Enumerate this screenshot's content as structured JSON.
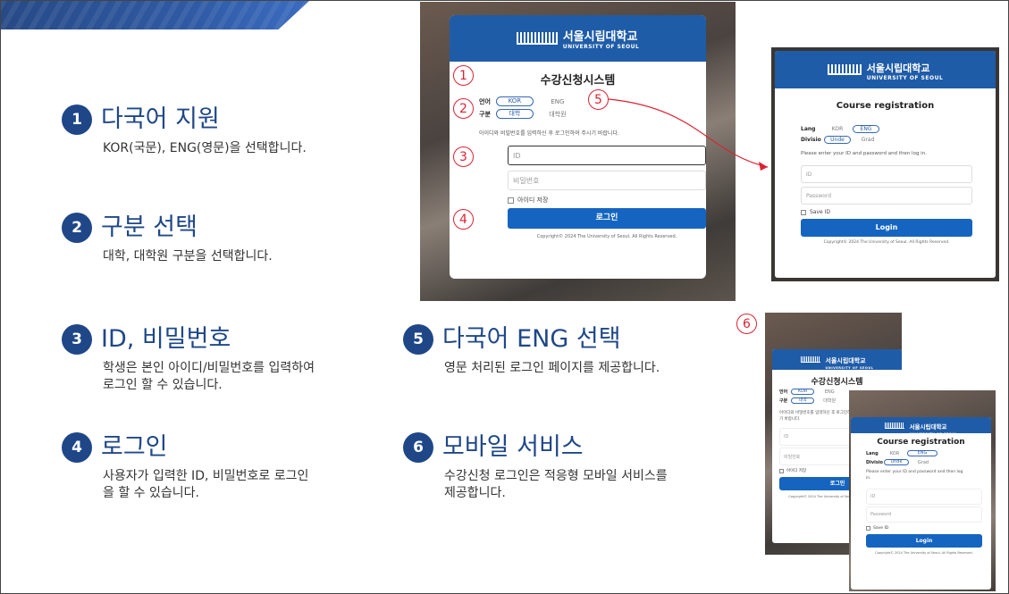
{
  "features": [
    {
      "num": "1",
      "title": "다국어 지원",
      "desc": [
        "KOR(국문), ENG(영문)을 선택합니다."
      ]
    },
    {
      "num": "2",
      "title": "구분 선택",
      "desc": [
        "대학, 대학원 구분을 선택합니다."
      ]
    },
    {
      "num": "3",
      "title": "ID, 비밀번호",
      "desc": [
        "학생은 본인 아이디/비밀번호를 입력하여",
        "로그인 할 수 있습니다."
      ]
    },
    {
      "num": "4",
      "title": "로그인",
      "desc": [
        "사용자가 입력한 ID, 비밀번호로 로그인",
        "을 할 수 있습니다."
      ]
    },
    {
      "num": "5",
      "title": "다국어 ENG 선택",
      "desc": [
        "영문 처리된 로그인 페이지를 제공합니다."
      ]
    },
    {
      "num": "6",
      "title": "모바일 서비스",
      "desc": [
        "수강신청 로그인은 적응형 모바일 서비스를",
        "제공합니다."
      ]
    }
  ],
  "markers": [
    "1",
    "2",
    "3",
    "4",
    "5",
    "6"
  ],
  "logo": {
    "korean": "서울시립대학교",
    "english": "UNIVERSITY OF SEOUL"
  },
  "login_kor": {
    "title": "수강신청시스템",
    "lang_label": "언어",
    "lang_kor": "KOR",
    "lang_eng": "ENG",
    "div_label": "구분",
    "div_univ": "대학",
    "div_grad": "대학원",
    "hint": "아이디와 비밀번호를 입력하신 후 로그인하여 주시기 바랍니다.",
    "hint_mobile_1": "아이디와 비밀번호를 입력하신 후 로그인하여 주시",
    "hint_mobile_2": "기 바랍니다.",
    "id_placeholder": "ID",
    "pw_placeholder": "비밀번호",
    "save_id": "아이디 저장",
    "login": "로그인",
    "copyright": "Copyright© 2024 The University of Seoul. All Rights Reserved."
  },
  "login_eng": {
    "title": "Course registration",
    "lang_label": "Lang",
    "lang_kor": "KOR",
    "lang_eng": "ENG",
    "div_label": "Divisio",
    "div_univ": "Unde",
    "div_grad": "Grad",
    "hint": "Please enter your ID and password and then log in.",
    "hint_mobile_1": "Please enter your ID and password and then log",
    "hint_mobile_2": "in.",
    "id_placeholder": "ID",
    "pw_placeholder": "Password",
    "save_id": "Save ID",
    "login": "Login",
    "copyright": "Copyright© 2024 The University of Seoul. All Rights Reserved."
  },
  "colors": {
    "primary": "#1f4788",
    "header": "#1f5ca8",
    "button": "#1565c0",
    "marker": "#dd2233"
  }
}
